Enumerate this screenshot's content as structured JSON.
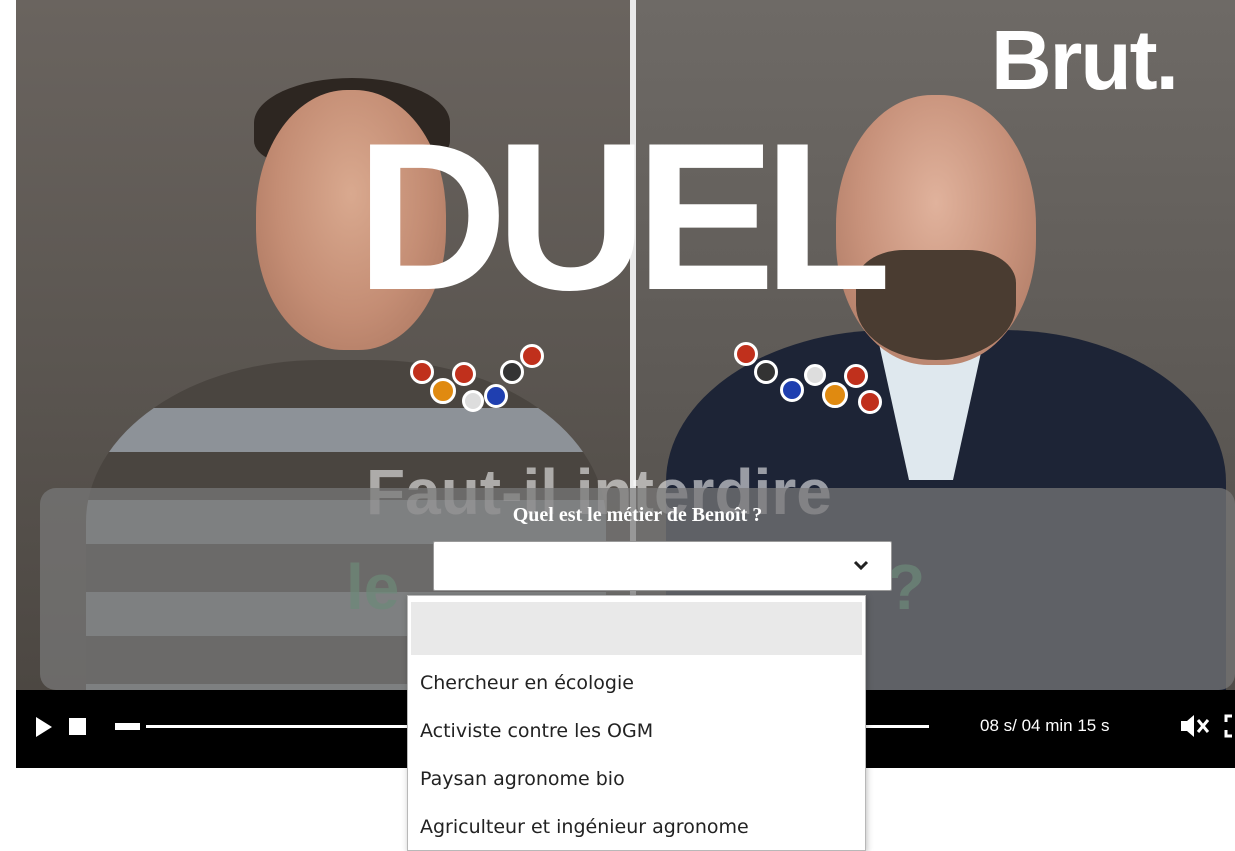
{
  "video": {
    "brand_logo": "Brut.",
    "title_overlay": "DUEL",
    "subtitle_line1": "Faut-il interdire",
    "subtitle_line2_start": "le",
    "subtitle_line2_end": "?"
  },
  "quiz": {
    "question": "Quel est le métier de Benoît ?",
    "selected_value": "",
    "options": [
      "",
      "Chercheur en écologie",
      "Activiste contre les OGM",
      "Paysan agronome bio",
      "Agriculteur et ingénieur agronome"
    ]
  },
  "controls": {
    "time_readout": "08 s/ 04 min 15 s",
    "progress_fraction": 0.031,
    "muted": true
  },
  "icons": {
    "play": "play-icon",
    "stop": "stop-icon",
    "mute": "volume-muted-icon",
    "fullscreen": "fullscreen-icon",
    "chevron": "chevron-down-icon"
  }
}
